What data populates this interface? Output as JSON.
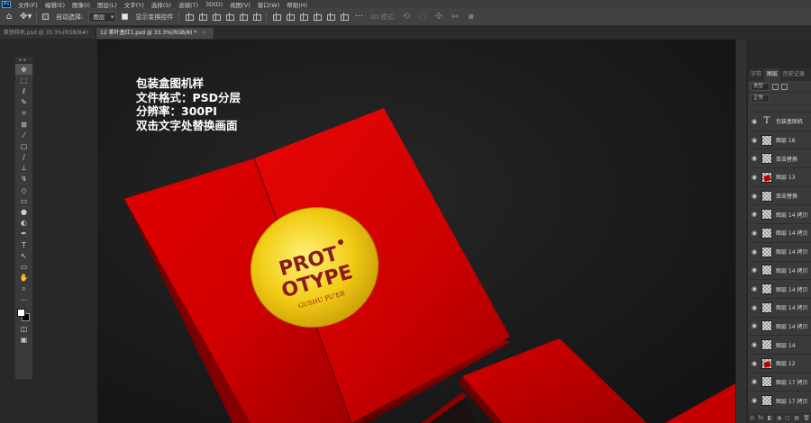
{
  "menu": {
    "logo": "Ps",
    "items": [
      "文件(F)",
      "编辑(E)",
      "图像(I)",
      "图层(L)",
      "文字(Y)",
      "选择(S)",
      "滤镜(T)",
      "3D(D)",
      "视图(V)",
      "窗口(W)",
      "帮助(H)"
    ]
  },
  "options": {
    "auto_select_label": "自动选择:",
    "auto_select_target": "图层",
    "show_transform_label": "显示变换控件",
    "mode_3d_label": "3D 模式:"
  },
  "tabs": [
    {
      "label": "茶饼样机.psd @ 33.3%(RGB/8#)",
      "active": false,
      "close": ""
    },
    {
      "label": "12 茶叶盒红1.psd @ 33.3%(RGB/8) *",
      "active": true,
      "close": "×"
    }
  ],
  "canvas": {
    "info_lines": [
      "包装盒图机样",
      "文件格式：PSD分层",
      "分辨率：300PI",
      "双击文字处替换画面"
    ],
    "label_line1": "PROT",
    "label_line2": "OTYPE",
    "label_arc_text": "GUSHU PU'ER",
    "colors": {
      "box_red": "#d40000",
      "gold": "#f3d21c",
      "label_text": "#8b1a1a"
    }
  },
  "tools_panel": {
    "grip": "▸▸",
    "tools": [
      {
        "name": "move-tool-icon",
        "glyph": "✥"
      },
      {
        "name": "marquee-tool-icon",
        "glyph": "⬚"
      },
      {
        "name": "lasso-tool-icon",
        "glyph": "ℓ"
      },
      {
        "name": "quick-select-tool-icon",
        "glyph": "✎"
      },
      {
        "name": "crop-tool-icon",
        "glyph": "⌗"
      },
      {
        "name": "frame-tool-icon",
        "glyph": "⊠"
      },
      {
        "name": "eyedropper-tool-icon",
        "glyph": "⁄"
      },
      {
        "name": "healing-brush-tool-icon",
        "glyph": "▢"
      },
      {
        "name": "brush-tool-icon",
        "glyph": "∕"
      },
      {
        "name": "clone-stamp-tool-icon",
        "glyph": "⊥"
      },
      {
        "name": "history-brush-tool-icon",
        "glyph": "↯"
      },
      {
        "name": "eraser-tool-icon",
        "glyph": "◇"
      },
      {
        "name": "gradient-tool-icon",
        "glyph": "▭"
      },
      {
        "name": "blur-tool-icon",
        "glyph": "●"
      },
      {
        "name": "dodge-tool-icon",
        "glyph": "◐"
      },
      {
        "name": "pen-tool-icon",
        "glyph": "✒"
      },
      {
        "name": "type-tool-icon",
        "glyph": "T"
      },
      {
        "name": "path-select-tool-icon",
        "glyph": "↖"
      },
      {
        "name": "shape-tool-icon",
        "glyph": "▭"
      },
      {
        "name": "hand-tool-icon",
        "glyph": "✋"
      },
      {
        "name": "zoom-tool-icon",
        "glyph": "⌕"
      },
      {
        "name": "more-tools-icon",
        "glyph": "···"
      }
    ],
    "bottom": [
      {
        "name": "quick-mask-icon",
        "glyph": "◫"
      },
      {
        "name": "screen-mode-icon",
        "glyph": "▣"
      }
    ],
    "foreground_color": "#ffffff",
    "background_color": "#000000"
  },
  "layers_panel": {
    "tabs": [
      "字符",
      "图层",
      "历史记录"
    ],
    "filter_label": "类型",
    "blend_mode": "正常",
    "layers": [
      {
        "name": "包装盒图机",
        "thumb": "text"
      },
      {
        "name": "图层 16",
        "thumb": "checker"
      },
      {
        "name": "双击替换",
        "thumb": "checker"
      },
      {
        "name": "图层 13",
        "thumb": "red"
      },
      {
        "name": "双击替换",
        "thumb": "checker"
      },
      {
        "name": "图层 14 拷贝",
        "thumb": "checker"
      },
      {
        "name": "图层 14 拷贝",
        "thumb": "checker"
      },
      {
        "name": "图层 14 拷贝",
        "thumb": "checker"
      },
      {
        "name": "图层 14 拷贝",
        "thumb": "checker"
      },
      {
        "name": "图层 14 拷贝",
        "thumb": "checker"
      },
      {
        "name": "图层 14 拷贝",
        "thumb": "checker"
      },
      {
        "name": "图层 14 拷贝",
        "thumb": "checker"
      },
      {
        "name": "图层 14",
        "thumb": "checker"
      },
      {
        "name": "图层 12",
        "thumb": "red"
      },
      {
        "name": "图层 17 拷贝",
        "thumb": "checker"
      },
      {
        "name": "图层 17 拷贝",
        "thumb": "checker"
      }
    ],
    "footer_icons": [
      "⊝",
      "fx",
      "◧",
      "◑",
      "▢",
      "▤",
      "🗑"
    ]
  }
}
